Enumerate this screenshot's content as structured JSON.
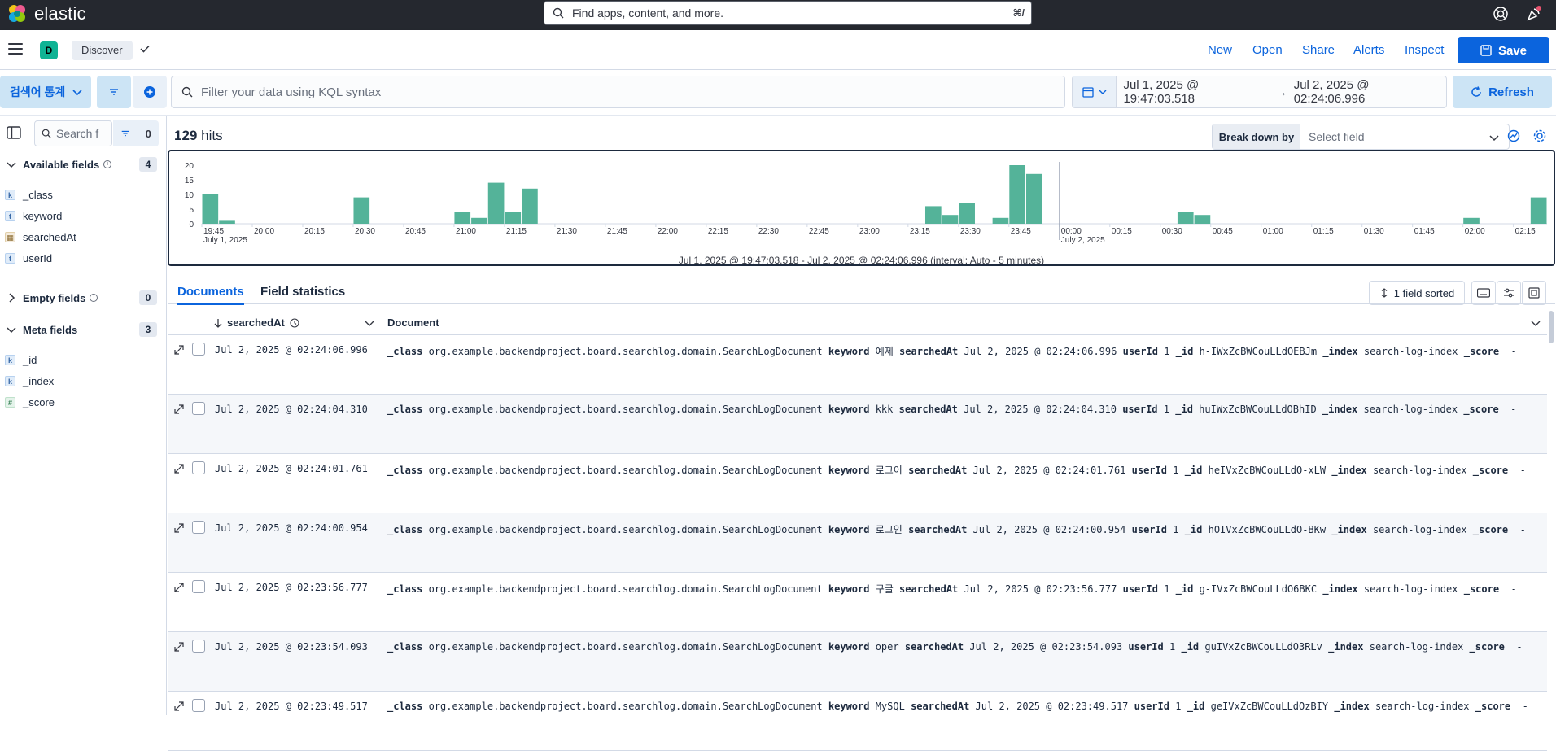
{
  "app": {
    "brand": "elastic"
  },
  "global_search": {
    "placeholder": "Find apps, content, and more.",
    "shortcut": "⌘/"
  },
  "breadcrumb": {
    "space_initial": "D",
    "current": "Discover"
  },
  "top_menu": {
    "new": "New",
    "open": "Open",
    "share": "Share",
    "alerts": "Alerts",
    "inspect": "Inspect",
    "save": "Save"
  },
  "query": {
    "data_view": "검색어 통계",
    "kql_placeholder": "Filter your data using KQL syntax",
    "time_from": "Jul 1, 2025 @ 19:47:03.518",
    "time_arrow": "→",
    "time_to": "Jul 2, 2025 @ 02:24:06.996",
    "refresh": "Refresh"
  },
  "sidebar": {
    "search_placeholder": "Search f",
    "filter_count": "0",
    "available": {
      "title": "Available fields",
      "count": "4",
      "fields": [
        {
          "type": "k",
          "name": "_class"
        },
        {
          "type": "t",
          "name": "keyword"
        },
        {
          "type": "d",
          "name": "searchedAt"
        },
        {
          "type": "t",
          "name": "userId"
        }
      ]
    },
    "empty": {
      "title": "Empty fields",
      "count": "0"
    },
    "meta": {
      "title": "Meta fields",
      "count": "3",
      "fields": [
        {
          "type": "k",
          "name": "_id"
        },
        {
          "type": "k",
          "name": "_index"
        },
        {
          "type": "#",
          "name": "_score"
        }
      ]
    }
  },
  "hits": {
    "count": "129",
    "label": "hits"
  },
  "breakdown": {
    "label": "Break down by",
    "placeholder": "Select field"
  },
  "chart_data": {
    "type": "bar",
    "y_ticks": [
      "20",
      "15",
      "10",
      "5",
      "0"
    ],
    "ylim": [
      0,
      20
    ],
    "x_ticks": [
      "19:45",
      "20:00",
      "20:15",
      "20:30",
      "20:45",
      "21:00",
      "21:15",
      "21:30",
      "21:45",
      "22:00",
      "22:15",
      "22:30",
      "22:45",
      "23:00",
      "23:15",
      "23:30",
      "23:45",
      "00:00",
      "00:15",
      "00:30",
      "00:45",
      "01:00",
      "01:15",
      "01:30",
      "01:45",
      "02:00",
      "02:15"
    ],
    "date_labels": [
      {
        "at": "19:45",
        "label": "July 1, 2025"
      },
      {
        "at": "00:00",
        "label": "July 2, 2025"
      }
    ],
    "bars": [
      {
        "t": "19:45",
        "v": 10
      },
      {
        "t": "19:50",
        "v": 1
      },
      {
        "t": "20:30",
        "v": 9
      },
      {
        "t": "21:00",
        "v": 4
      },
      {
        "t": "21:05",
        "v": 2
      },
      {
        "t": "21:10",
        "v": 14
      },
      {
        "t": "21:15",
        "v": 4
      },
      {
        "t": "21:20",
        "v": 12
      },
      {
        "t": "23:20",
        "v": 6
      },
      {
        "t": "23:25",
        "v": 3
      },
      {
        "t": "23:30",
        "v": 7
      },
      {
        "t": "23:40",
        "v": 2
      },
      {
        "t": "23:45",
        "v": 20
      },
      {
        "t": "23:50",
        "v": 17
      },
      {
        "t": "00:35",
        "v": 4
      },
      {
        "t": "00:40",
        "v": 3
      },
      {
        "t": "02:00",
        "v": 2
      },
      {
        "t": "02:20",
        "v": 9
      }
    ],
    "color": "#54b399",
    "caption": "Jul 1, 2025 @ 19:47:03.518 - Jul 2, 2025 @ 02:24:06.996 (interval: Auto - 5 minutes)"
  },
  "tabs": {
    "documents": "Documents",
    "field_statistics": "Field statistics"
  },
  "grid": {
    "sorted_label": "1 field sorted",
    "col_time": "searchedAt",
    "col_doc": "Document",
    "rows": [
      {
        "time": "Jul 2, 2025 @ 02:24:06.996",
        "class": "org.example.backendproject.board.searchlog.domain.SearchLogDocument",
        "keyword": "예제",
        "searchedAt": "Jul 2, 2025 @ 02:24:06.996",
        "userId": "1",
        "id": "h-IWxZcBWCouLLdOEBJm",
        "index": "search-log-index",
        "score": "-"
      },
      {
        "time": "Jul 2, 2025 @ 02:24:04.310",
        "class": "org.example.backendproject.board.searchlog.domain.SearchLogDocument",
        "keyword": "kkk",
        "searchedAt": "Jul 2, 2025 @ 02:24:04.310",
        "userId": "1",
        "id": "huIWxZcBWCouLLdOBhID",
        "index": "search-log-index",
        "score": "-"
      },
      {
        "time": "Jul 2, 2025 @ 02:24:01.761",
        "class": "org.example.backendproject.board.searchlog.domain.SearchLogDocument",
        "keyword": "로그이",
        "searchedAt": "Jul 2, 2025 @ 02:24:01.761",
        "userId": "1",
        "id": "heIVxZcBWCouLLdO-xLW",
        "index": "search-log-index",
        "score": "-"
      },
      {
        "time": "Jul 2, 2025 @ 02:24:00.954",
        "class": "org.example.backendproject.board.searchlog.domain.SearchLogDocument",
        "keyword": "로그인",
        "searchedAt": "Jul 2, 2025 @ 02:24:00.954",
        "userId": "1",
        "id": "hOIVxZcBWCouLLdO-BKw",
        "index": "search-log-index",
        "score": "-"
      },
      {
        "time": "Jul 2, 2025 @ 02:23:56.777",
        "class": "org.example.backendproject.board.searchlog.domain.SearchLogDocument",
        "keyword": "구글",
        "searchedAt": "Jul 2, 2025 @ 02:23:56.777",
        "userId": "1",
        "id": "g-IVxZcBWCouLLdO6BKC",
        "index": "search-log-index",
        "score": "-"
      },
      {
        "time": "Jul 2, 2025 @ 02:23:54.093",
        "class": "org.example.backendproject.board.searchlog.domain.SearchLogDocument",
        "keyword": "oper",
        "searchedAt": "Jul 2, 2025 @ 02:23:54.093",
        "userId": "1",
        "id": "guIVxZcBWCouLLdO3RLv",
        "index": "search-log-index",
        "score": "-"
      },
      {
        "time": "Jul 2, 2025 @ 02:23:49.517",
        "class": "org.example.backendproject.board.searchlog.domain.SearchLogDocument",
        "keyword": "MySQL",
        "searchedAt": "Jul 2, 2025 @ 02:23:49.517",
        "userId": "1",
        "id": "geIVxZcBWCouLLdOzBIY",
        "index": "search-log-index",
        "score": "-"
      }
    ]
  }
}
